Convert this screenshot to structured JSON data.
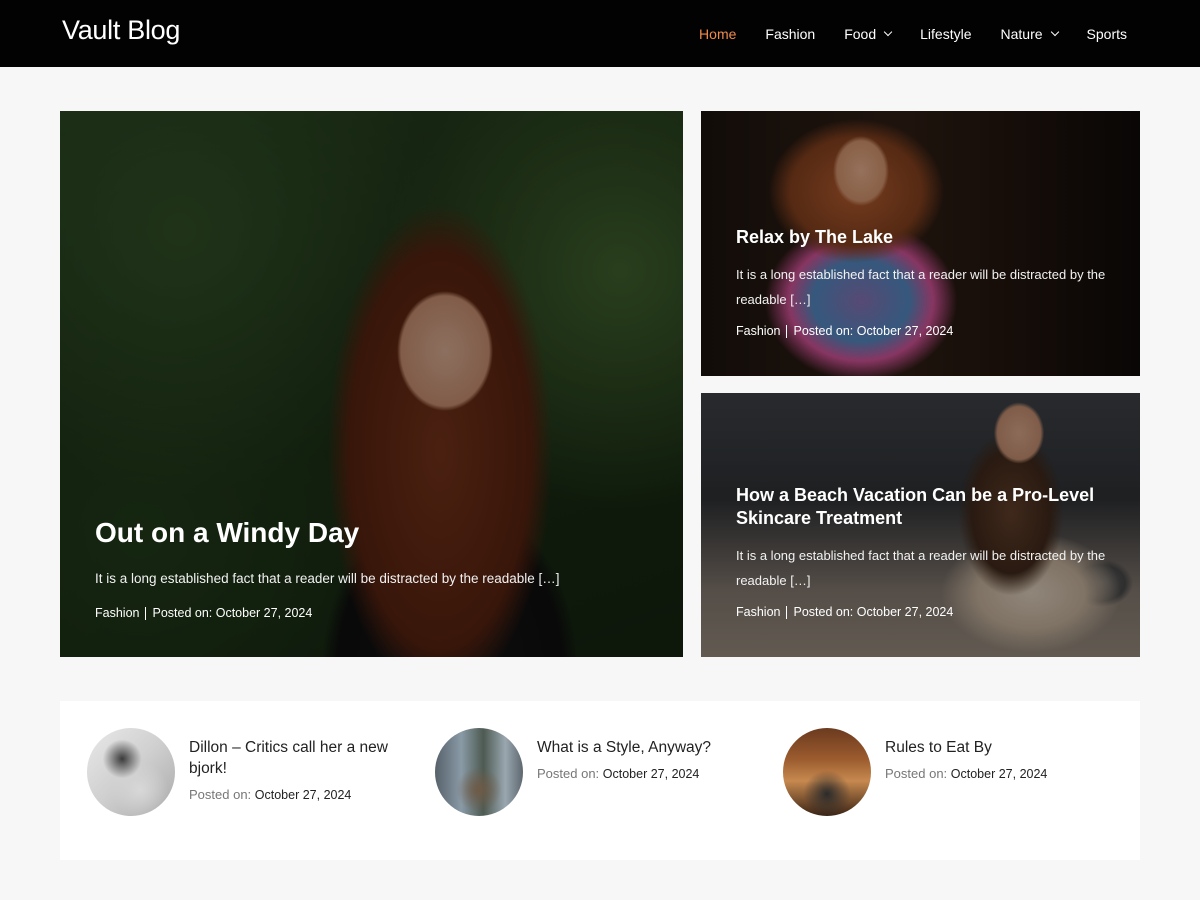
{
  "header": {
    "logo": "Vault Blog",
    "nav": [
      {
        "label": "Home",
        "active": true,
        "dropdown": false
      },
      {
        "label": "Fashion",
        "active": false,
        "dropdown": false
      },
      {
        "label": "Food",
        "active": false,
        "dropdown": true
      },
      {
        "label": "Lifestyle",
        "active": false,
        "dropdown": false
      },
      {
        "label": "Nature",
        "active": false,
        "dropdown": true
      },
      {
        "label": "Sports",
        "active": false,
        "dropdown": false
      }
    ],
    "active_color": "#f08a4b"
  },
  "featured": [
    {
      "title": "Out on a Windy Day",
      "excerpt": "It is a long established fact that a reader will be distracted by the readable […]",
      "category": "Fashion",
      "posted_label": "Posted on:",
      "date": "October 27, 2024"
    },
    {
      "title": "Relax by The Lake",
      "excerpt": "It is a long established fact that a reader will be distracted by the readable […]",
      "category": "Fashion",
      "posted_label": "Posted on:",
      "date": "October 27, 2024"
    },
    {
      "title": "How a Beach Vacation Can be a Pro-Level Skincare Treatment",
      "excerpt": "It is a long established fact that a reader will be distracted by the readable […]",
      "category": "Fashion",
      "posted_label": "Posted on:",
      "date": "October 27, 2024"
    }
  ],
  "recent_posts": [
    {
      "title": "Dillon – Critics call her a new bjork!",
      "posted_label": "Posted on:",
      "date": "October 27, 2024"
    },
    {
      "title": "What is a Style, Anyway?",
      "posted_label": "Posted on:",
      "date": "October 27, 2024"
    },
    {
      "title": "Rules to Eat By",
      "posted_label": "Posted on:",
      "date": "October 27, 2024"
    }
  ]
}
